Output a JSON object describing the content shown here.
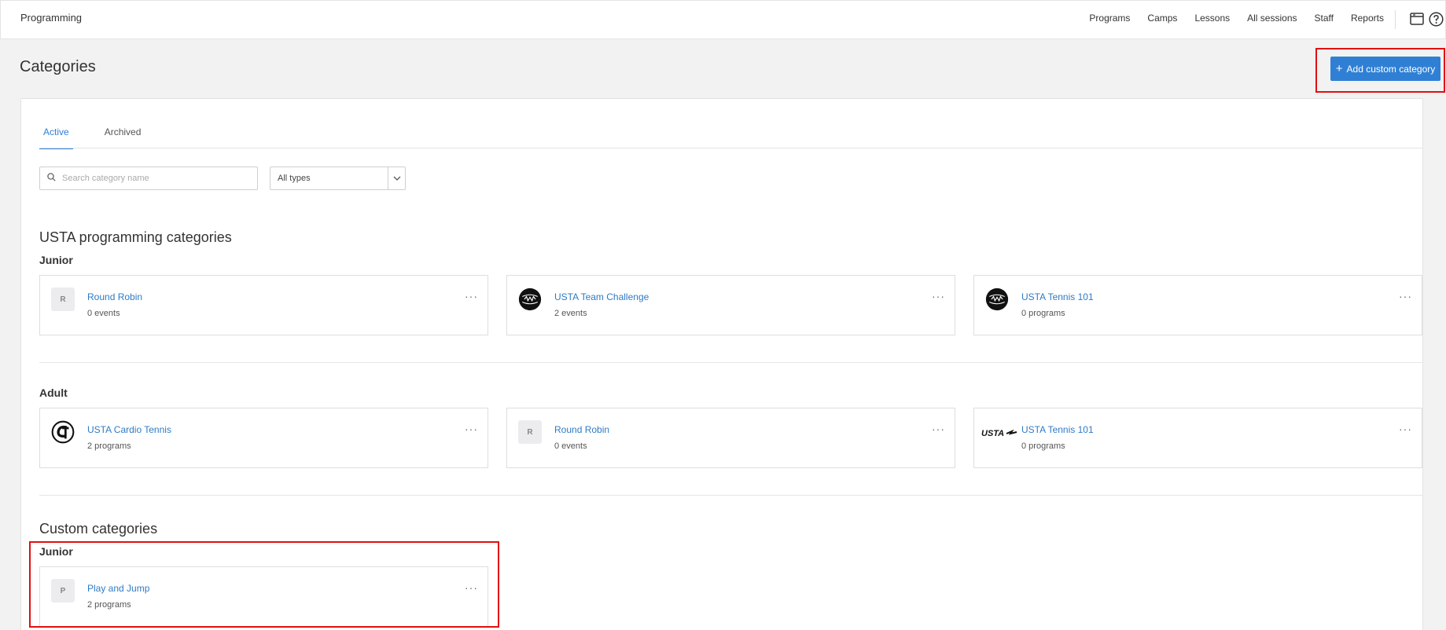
{
  "app": {
    "title": "Programming"
  },
  "topnav": [
    "Programs",
    "Camps",
    "Lessons",
    "All sessions",
    "Staff",
    "Reports"
  ],
  "header": {
    "title": "Categories",
    "add_button": "Add custom category"
  },
  "tabs": [
    {
      "label": "Active",
      "active": true
    },
    {
      "label": "Archived",
      "active": false
    }
  ],
  "filters": {
    "search_placeholder": "Search category name",
    "type_value": "All types"
  },
  "usta": {
    "title": "USTA programming categories",
    "junior": {
      "label": "Junior",
      "cards": [
        {
          "initial": "R",
          "name": "Round Robin",
          "meta": "0 events",
          "icon": "letter-avatar"
        },
        {
          "name": "USTA Team Challenge",
          "meta": "2 events",
          "icon": "netgen-logo"
        },
        {
          "name": "USTA Tennis 101",
          "meta": "0 programs",
          "icon": "netgen-logo"
        }
      ]
    },
    "adult": {
      "label": "Adult",
      "cards": [
        {
          "name": "USTA Cardio Tennis",
          "meta": "2 programs",
          "icon": "cardio-tennis-logo"
        },
        {
          "initial": "R",
          "name": "Round Robin",
          "meta": "0 events",
          "icon": "letter-avatar"
        },
        {
          "name": "USTA Tennis 101",
          "meta": "0 programs",
          "icon": "usta-logo",
          "logo_text": "USTA"
        }
      ]
    }
  },
  "custom": {
    "title": "Custom categories",
    "junior": {
      "label": "Junior",
      "cards": [
        {
          "initial": "P",
          "name": "Play and Jump",
          "meta": "2 programs",
          "icon": "letter-avatar"
        }
      ]
    }
  },
  "colors": {
    "accent": "#2f80d5",
    "link": "#2f7bc4",
    "highlight": "#e01010"
  }
}
